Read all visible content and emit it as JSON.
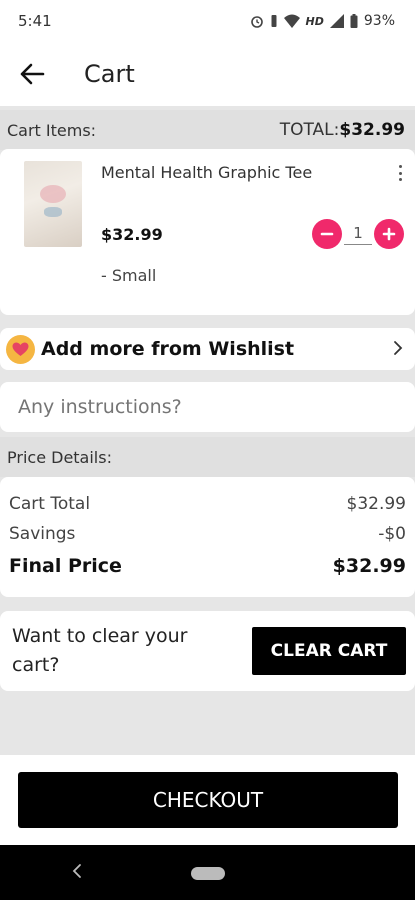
{
  "status_bar": {
    "time": "5:41",
    "network": "HD",
    "battery": "93%"
  },
  "app_bar": {
    "title": "Cart",
    "back_icon": "arrow-left-icon"
  },
  "cart_header": {
    "label": "Cart Items:",
    "total_label": "TOTAL:",
    "total_value": "$32.99"
  },
  "cart_item": {
    "name": "Mental Health Graphic Tee",
    "price": "$32.99",
    "size": "- Small",
    "quantity": "1",
    "accent_color": "#f0296b"
  },
  "wishlist": {
    "label": "Add more from Wishlist",
    "icon": "heart-icon"
  },
  "instructions": {
    "placeholder": "Any instructions?"
  },
  "price_details": {
    "header": "Price Details:",
    "rows": [
      {
        "label": "Cart Total",
        "value": "$32.99"
      },
      {
        "label": "Savings",
        "value": "-$0"
      }
    ],
    "final_label": "Final Price",
    "final_value": "$32.99"
  },
  "clear_cart": {
    "prompt": "Want to clear your cart?",
    "button_label": "CLEAR CART"
  },
  "checkout": {
    "button_label": "CHECKOUT"
  }
}
